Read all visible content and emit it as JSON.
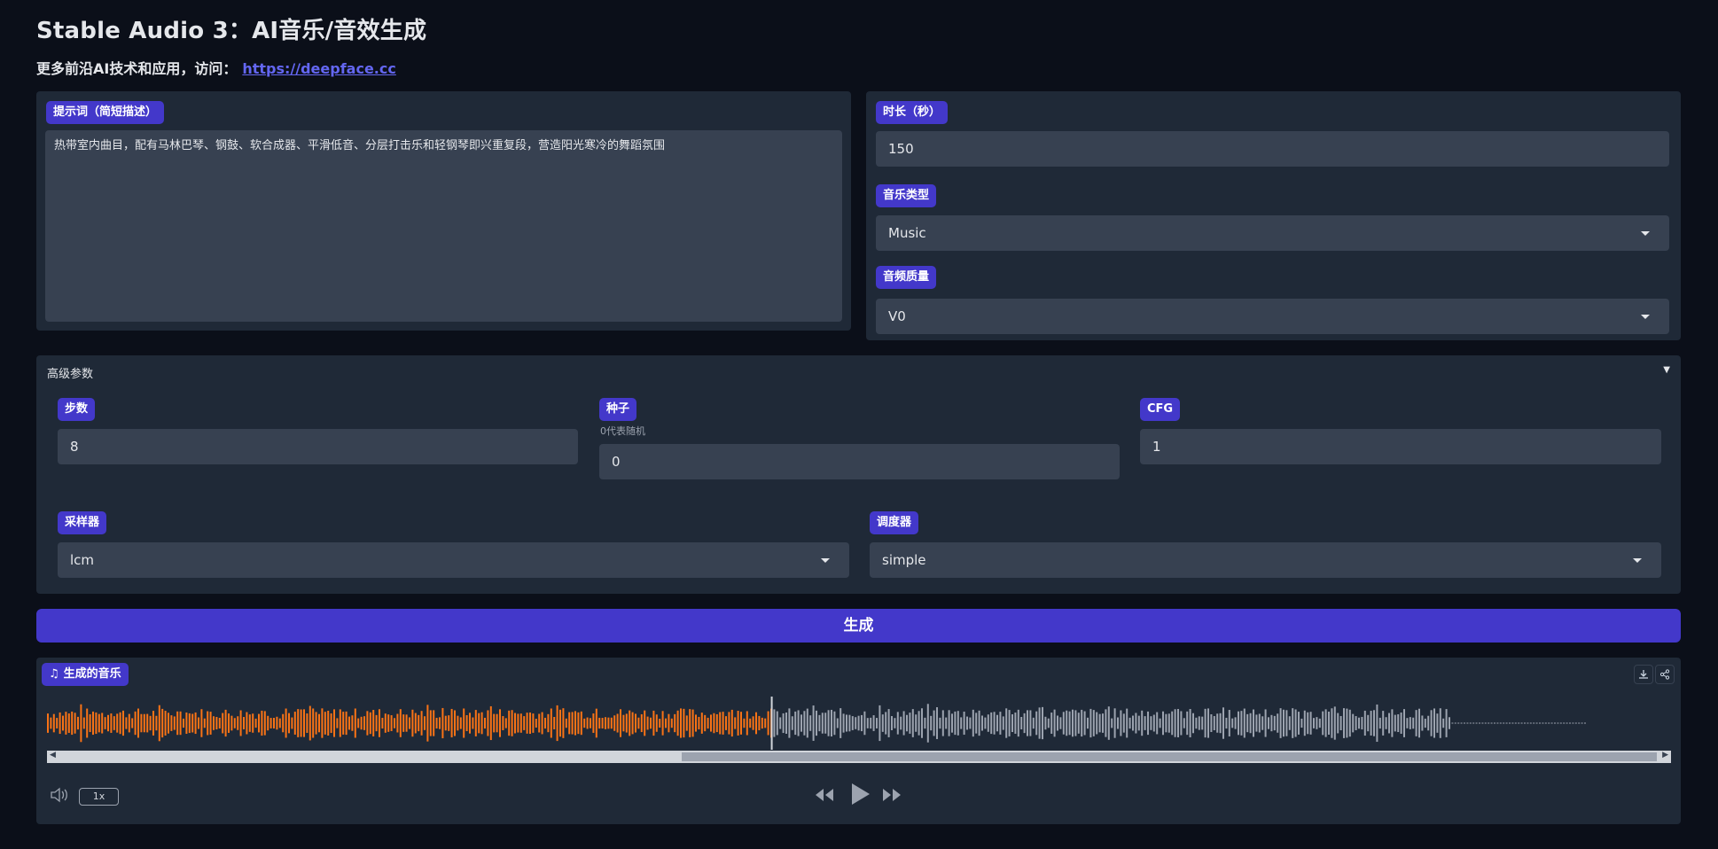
{
  "header": {
    "title": "Stable Audio 3：AI音乐/音效生成",
    "subtitle": "更多前沿AI技术和应用，访问：",
    "link": "https://deepface.cc"
  },
  "prompt": {
    "label": "提示词（简短描述）",
    "value": "热带室内曲目，配有马林巴琴、钢鼓、软合成器、平滑低音、分层打击乐和轻钢琴即兴重复段，营造阳光寒冷的舞蹈氛围"
  },
  "duration": {
    "label": "时长（秒）",
    "value": "150"
  },
  "music_type": {
    "label": "音乐类型",
    "value": "Music"
  },
  "quality": {
    "label": "音频质量",
    "value": "V0"
  },
  "advanced": {
    "title": "高级参数",
    "toggle": "▼",
    "steps": {
      "label": "步数",
      "value": "8"
    },
    "seed": {
      "label": "种子",
      "hint": "0代表随机",
      "value": "0"
    },
    "cfg": {
      "label": "CFG",
      "value": "1"
    },
    "sampler": {
      "label": "采样器",
      "value": "lcm"
    },
    "scheduler": {
      "label": "调度器",
      "value": "simple"
    }
  },
  "generate_label": "生成",
  "audio": {
    "label": "生成的音乐",
    "speed": "1x",
    "progress": 0.47,
    "colors": {
      "played": "#f97316",
      "unplayed": "#9ca3af"
    }
  },
  "colors": {
    "accent": "#4338ca",
    "background": "#0b0f19",
    "panel": "#1f2937",
    "field": "#374151"
  }
}
